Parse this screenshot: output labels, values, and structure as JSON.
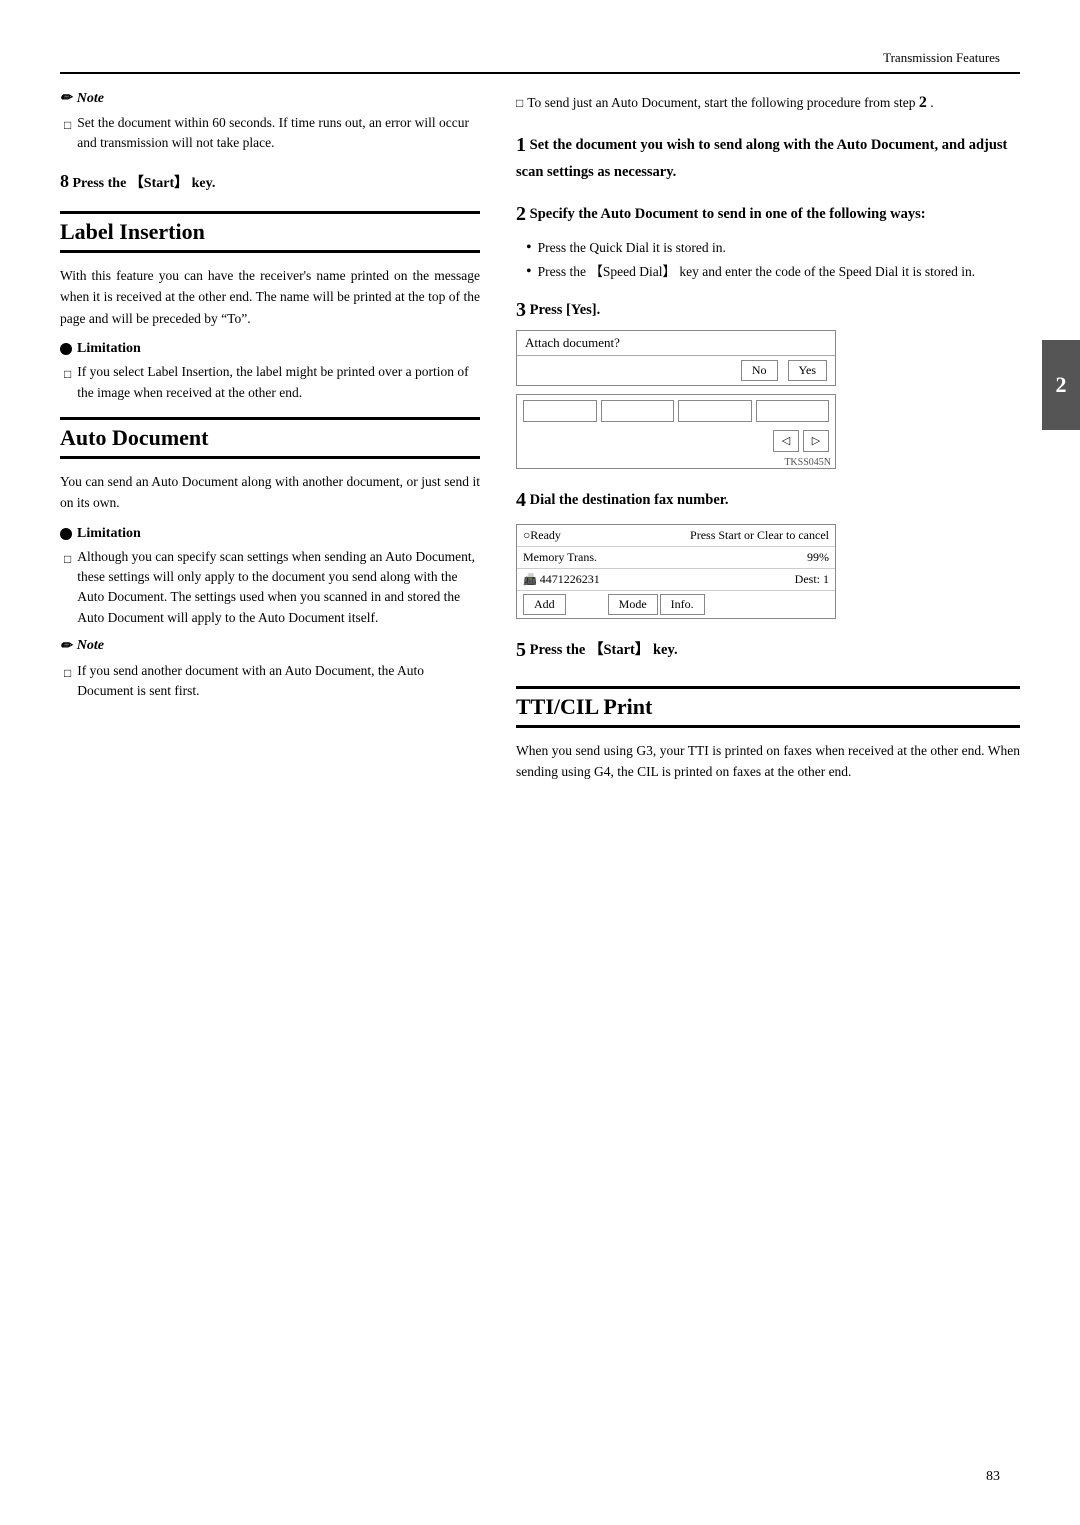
{
  "header": {
    "title": "Transmission Features"
  },
  "page_number": "83",
  "side_tab": "2",
  "left_col": {
    "note1": {
      "label": "Note",
      "items": [
        "Set the document within 60 seconds. If time runs out, an error will occur and transmission will not take place."
      ]
    },
    "step8": {
      "text": "Press the 【Start】 key."
    },
    "label_insertion": {
      "title": "Label Insertion",
      "body": "With this feature you can have the receiver's name printed on the message when it is received at the other end. The name will be printed at the top of the page and will be preceded by “To”.",
      "limitation": {
        "label": "Limitation",
        "items": [
          "If you select Label Insertion, the label might be printed over a portion of the image when received at the other end."
        ]
      }
    },
    "auto_document": {
      "title": "Auto Document",
      "body": "You can send an Auto Document along with another document, or just send it on its own.",
      "limitation": {
        "label": "Limitation",
        "items": [
          "Although you can specify scan settings when sending an Auto Document, these settings will only apply to the document you send along with the Auto Document. The settings used when you scanned in and stored the Auto Document will apply to the Auto Document itself."
        ]
      },
      "note": {
        "label": "Note",
        "items": [
          "If you send another document with an Auto Document, the Auto Document is sent first."
        ]
      }
    }
  },
  "right_col": {
    "intro": {
      "text": "To send just an Auto Document, start the following procedure from step",
      "step_ref": "2"
    },
    "step1": {
      "num": "1",
      "text": "Set the document you wish to send along with the Auto Document, and adjust scan settings as necessary."
    },
    "step2": {
      "num": "2",
      "text": "Specify the Auto Document to send in one of the following ways:",
      "bullets": [
        "Press the Quick Dial it is stored in.",
        "Press the 【Speed Dial】 key and enter the code of the Speed Dial it is stored in."
      ]
    },
    "step3": {
      "num": "3",
      "label": "Press [Yes].",
      "dialog": {
        "text": "Attach document?",
        "btn_no": "No",
        "btn_yes": "Yes"
      },
      "keypad_label": "TKSS045N"
    },
    "step4": {
      "num": "4",
      "text": "Dial the destination fax number.",
      "status": {
        "row1_left": "○Ready",
        "row1_right": "Press Start or Clear to cancel",
        "row2_left": "Memory Trans.",
        "row2_right": "99%",
        "row3_fax": "4471226231",
        "row3_dest": "Dest: 1",
        "btn_add": "Add",
        "btn_mode": "Mode",
        "btn_info": "Info."
      }
    },
    "step5": {
      "num": "5",
      "text": "Press the 【Start】 key."
    },
    "tticil": {
      "title": "TTI/CIL Print",
      "body": "When you send using G3, your TTI is printed on faxes when received at the other end. When sending using G4, the CIL is printed on faxes at the other end."
    }
  }
}
